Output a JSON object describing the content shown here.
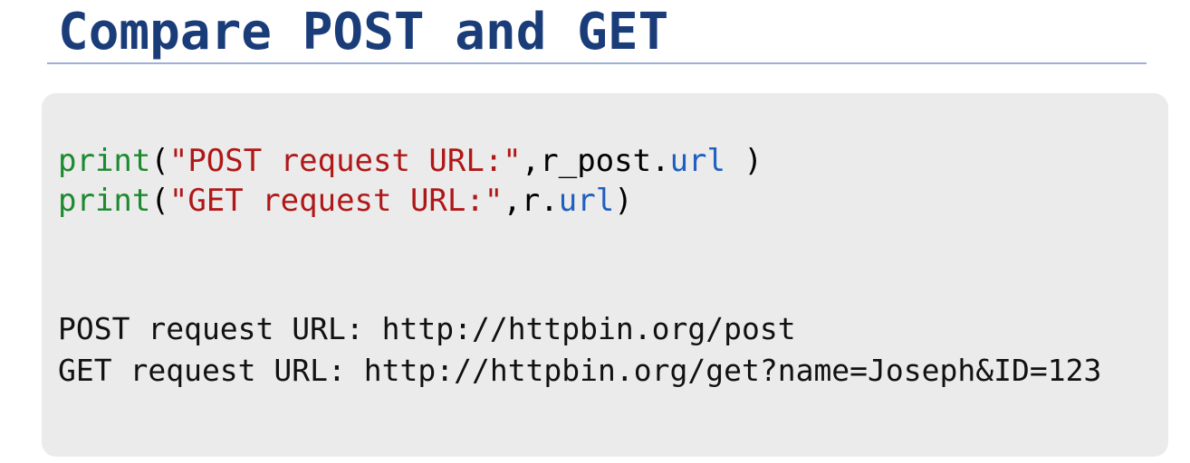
{
  "slide": {
    "title": "Compare POST and GET"
  },
  "colors": {
    "title": "#1a3d7a",
    "rule": "#9fb0d6",
    "keyword": "#1c8a2e",
    "string": "#b01818",
    "attribute": "#1f5fc0",
    "plain": "#000000",
    "panel": "#ebebeb"
  },
  "code": {
    "line1": {
      "func": "print",
      "open": "(",
      "string": "\"POST request URL:\"",
      "sep": ",",
      "object": "r_post",
      "dot": ".",
      "attr": "url",
      "close": " )"
    },
    "line2": {
      "func": "print",
      "open": "(",
      "string": "\"GET request URL:\"",
      "sep": ",",
      "object": "r",
      "dot": ".",
      "attr": "url",
      "close": ")"
    }
  },
  "output": {
    "line1": "POST request URL: http://httpbin.org/post",
    "line2": "GET request URL: http://httpbin.org/get?name=Joseph&ID=123"
  }
}
